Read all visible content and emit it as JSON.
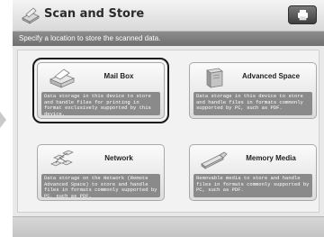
{
  "window": {
    "title": "Scan and Store",
    "title_icon": "scan-and-store-icon",
    "counter_button_icon": "counter-check-icon"
  },
  "instruction": "Specify a location to store the scanned data.",
  "options": [
    {
      "label": "Mail Box",
      "icon": "mail-box-icon",
      "description": "Data storage in this device to store and handle files for printing in format exclusively supported by this device.",
      "selected": true
    },
    {
      "label": "Advanced Space",
      "icon": "advanced-space-icon",
      "description": "Data storage in this device to store and handle files in formats commonly supported by PC, such as PDF.",
      "selected": false
    },
    {
      "label": "Network",
      "icon": "network-icon",
      "description": "Data storage on the Network (Remote Advanced Space) to store and handle files in formats commonly supported by PC, such as PDF.",
      "selected": false
    },
    {
      "label": "Memory Media",
      "icon": "memory-media-icon",
      "description": "Removable media to store and handle files in formats commonly supported by PC, such as PDF.",
      "selected": false
    }
  ],
  "colors": {
    "instruction_bar": "#7d7d7d",
    "description_box": "#8a8a8a",
    "selection_outline": "#1a1a1a"
  }
}
